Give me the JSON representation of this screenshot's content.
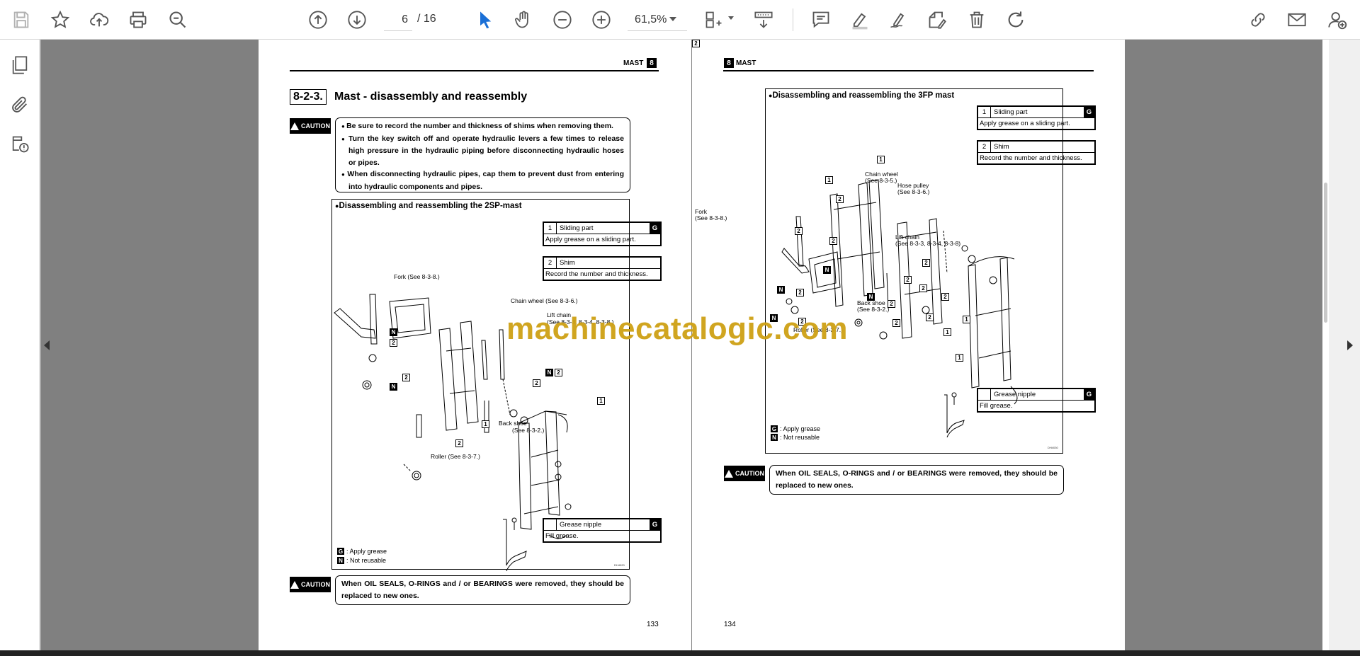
{
  "toolbar": {
    "current_page": "6",
    "total_pages": "/ 16",
    "zoom": "61,5%",
    "icons": [
      "save-icon",
      "star-icon",
      "cloud-upload-icon",
      "print-icon",
      "zoom-out-icon",
      "page-up-icon",
      "page-down-icon",
      "cursor-icon",
      "hand-icon",
      "minus-icon",
      "plus-icon",
      "page-layout-icon",
      "scroll-mode-icon",
      "comment-icon",
      "highlight-icon",
      "sign-icon",
      "stamp-icon",
      "delete-icon",
      "rotate-icon",
      "share-link-icon",
      "email-icon",
      "add-user-icon"
    ]
  },
  "sidebar": {
    "icons": [
      "pages-icon",
      "attachment-icon",
      "layers-icon"
    ]
  },
  "watermark": "machinecatalogic.com",
  "page_left": {
    "header": "MAST",
    "chapter": "8",
    "section_number": "8-2-3.",
    "section_title": "Mast - disassembly and reassembly",
    "caution_label": "CAUTION",
    "notes": [
      "Be sure to record the number and thickness of shims when removing them.",
      "Turn the key switch off and operate hydraulic levers a few times to release high pressure in the hydraulic piping before disconnecting hydraulic hoses or pipes.",
      "When disconnecting hydraulic pipes, cap them to prevent dust from entering into hydraulic components and pipes."
    ],
    "figure_title": "Disassembling and reassembling the 2SP-mast",
    "legend": [
      {
        "num": "1",
        "name": "Sliding part",
        "flag": "G",
        "desc": "Apply grease on a sliding part."
      },
      {
        "num": "2",
        "name": "Shim",
        "flag": "",
        "desc": "Record the number and thickness."
      }
    ],
    "grease_nipple": {
      "name": "Grease nipple",
      "flag": "G",
      "desc": "Fill grease."
    },
    "callouts": {
      "fork": "Fork (See 8-3-8.)",
      "chain_wheel": "Chain wheel (See 8-3-6.)",
      "lift_chain": "Lift chain",
      "lift_chain_ref": "(See 8-3-3, 8-3-4, 8-3-8.)",
      "back_shoe": "Back shoe",
      "back_shoe_ref": "(See 8-3-2.)",
      "roller": "Roller (See 8-3-7.)"
    },
    "key": [
      {
        "sym": "G",
        "text": ": Apply grease"
      },
      {
        "sym": "N",
        "text": ": Not reusable"
      }
    ],
    "fig_code": "DH4020",
    "bottom_caution": "When OIL SEALS, O-RINGS and / or BEARINGS were removed, they should be replaced to new ones.",
    "page_number": "133"
  },
  "page_right": {
    "header": "MAST",
    "chapter": "8",
    "caution_label": "CAUTION",
    "figure_title": "Disassembling and reassembling the 3FP mast",
    "legend": [
      {
        "num": "1",
        "name": "Sliding part",
        "flag": "G",
        "desc": "Apply grease on a sliding part."
      },
      {
        "num": "2",
        "name": "Shim",
        "flag": "",
        "desc": "Record the number and thickness."
      }
    ],
    "grease_nipple": {
      "name": "Grease nipple",
      "flag": "G",
      "desc": "Fill grease."
    },
    "callouts": {
      "fork": "Fork",
      "fork_ref": "(See 8-3-8.)",
      "chain_wheel": "Chain wheel",
      "chain_wheel_ref": "(See 8-3-5.)",
      "hose_pulley": "Hose pulley",
      "hose_pulley_ref": "(See 8-3-6.)",
      "lift_chain": "Lift chain",
      "lift_chain_ref": "(See 8-3-3, 8-3-4, 8-3-8)",
      "back_shoe": "Back shoe",
      "back_shoe_ref": "(See 8-3-2.)",
      "roller": "Roller (See 8-3-7.)"
    },
    "key": [
      {
        "sym": "G",
        "text": ": Apply grease"
      },
      {
        "sym": "N",
        "text": ": Not reusable"
      }
    ],
    "fig_code": "DH4030",
    "bottom_caution": "When OIL SEALS, O-RINGS and / or BEARINGS were removed, they should be replaced to new ones.",
    "page_number": "134"
  }
}
